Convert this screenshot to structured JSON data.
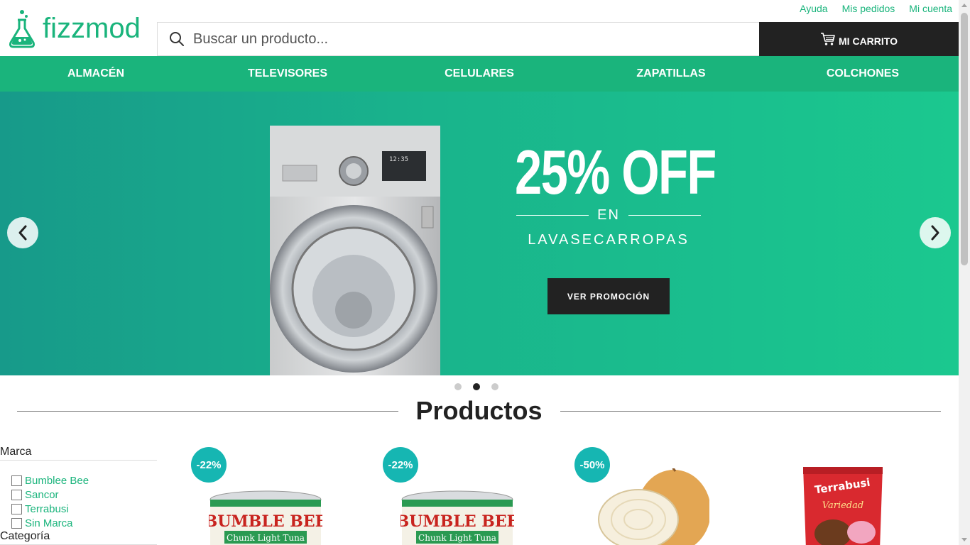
{
  "header": {
    "brand": "fizzmod",
    "toplinks": [
      "Ayuda",
      "Mis pedidos",
      "Mi cuenta"
    ],
    "search_placeholder": "Buscar un producto...",
    "cart_label": "MI CARRITO"
  },
  "nav": {
    "items": [
      "ALMACÉN",
      "TELEVISORES",
      "CELULARES",
      "ZAPATILLAS",
      "COLCHONES"
    ]
  },
  "hero": {
    "big_text": "25% OFF",
    "en_text": "EN",
    "sub_text": "LAVASECARROPAS",
    "button_label": "VER PROMOCIÓN",
    "slide_count": 3,
    "active_slide": 2
  },
  "products_heading": "Productos",
  "filters": {
    "brand_title": "Marca",
    "brands": [
      "Bumblee Bee",
      "Sancor",
      "Terrabusi",
      "Sin Marca"
    ],
    "category_title": "Categoría"
  },
  "products": [
    {
      "badge": "-22%",
      "image": "tuna-can",
      "image_text": "BUMBLE BEE",
      "image_subtext": "Chunk Light Tuna"
    },
    {
      "badge": "-22%",
      "image": "tuna-can",
      "image_text": "BUMBLE BEE",
      "image_subtext": "Chunk Light Tuna"
    },
    {
      "badge": "-50%",
      "image": "onion"
    },
    {
      "badge": "",
      "image": "cookie-bag",
      "image_text": "Terrabusi",
      "image_subtext": "Variedad"
    }
  ],
  "colors": {
    "accent": "#1ab47c",
    "dark": "#222222",
    "badge": "#16b6b2"
  }
}
